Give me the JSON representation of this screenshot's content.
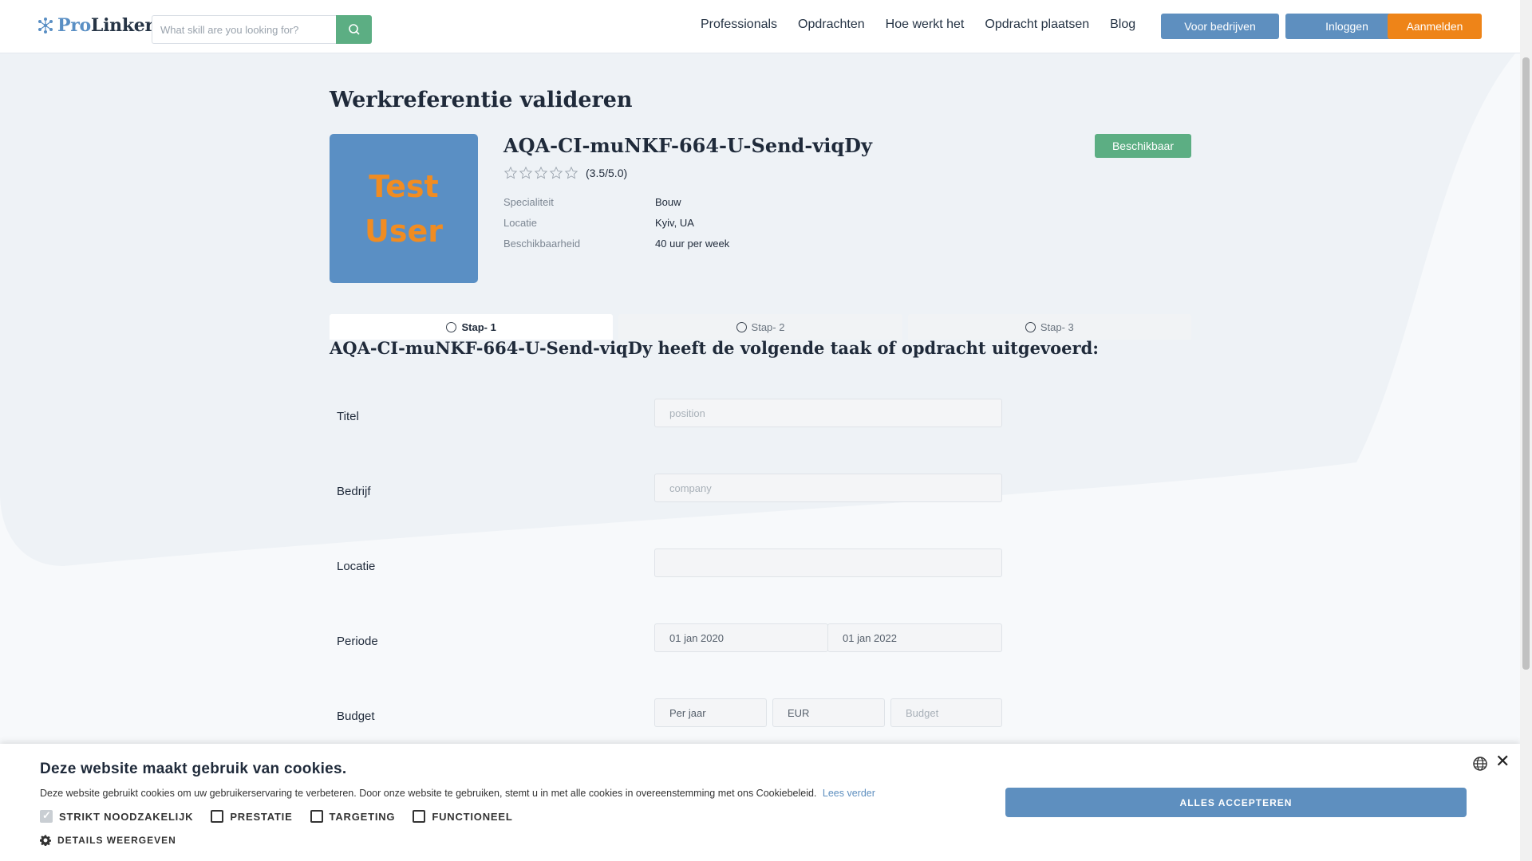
{
  "header": {
    "logo_pro": "Pro",
    "logo_linker": "Linker",
    "search_placeholder": "What skill are you looking for?",
    "nav": [
      "Professionals",
      "Opdrachten",
      "Hoe werkt het",
      "Opdracht plaatsen",
      "Blog"
    ],
    "btn_bedrijven": "Voor bedrijven",
    "btn_inloggen": "Inloggen",
    "btn_aanmelden": "Aanmelden"
  },
  "page": {
    "title": "Werkreferentie valideren"
  },
  "profile": {
    "avatar_line1": "Test",
    "avatar_line2": "User",
    "name": "AQA-CI-muNKF-664-U-Send-viqDy",
    "rating_value": 3.5,
    "rating_text": "(3.5/5.0)",
    "badge": "Beschikbaar",
    "details": [
      {
        "label": "Specialiteit",
        "value": "Bouw"
      },
      {
        "label": "Locatie",
        "value": "Kyiv, UA"
      },
      {
        "label": "Beschikbaarheid",
        "value": "40 uur per week"
      }
    ]
  },
  "steps": [
    "Stap- 1",
    "Stap- 2",
    "Stap- 3"
  ],
  "section_title": "AQA-CI-muNKF-664-U-Send-viqDy heeft de volgende taak of opdracht uitgevoerd:",
  "form": {
    "titel_label": "Titel",
    "titel_placeholder": "position",
    "bedrijf_label": "Bedrijf",
    "bedrijf_placeholder": "company",
    "locatie_label": "Locatie",
    "locatie_placeholder": "",
    "periode_label": "Periode",
    "periode_start": "01 jan 2020",
    "periode_end": "01 jan 2022",
    "budget_label": "Budget",
    "budget_period": "Per jaar",
    "budget_currency": "EUR",
    "budget_placeholder": "Budget"
  },
  "cookie": {
    "title": "Deze website maakt gebruik van cookies.",
    "text": "Deze website gebruikt cookies om uw gebruikerservaring te verbeteren. Door onze website te gebruiken, stemt u in met alle cookies in overeenstemming met ons Cookiebeleid.",
    "read_more": "Lees verder",
    "checks": [
      "STRIKT NOODZAKELIJK",
      "PRESTATIE",
      "TARGETING",
      "FUNCTIONEEL"
    ],
    "details": "DETAILS WEERGEVEN",
    "accept": "ALLES ACCEPTEREN"
  }
}
